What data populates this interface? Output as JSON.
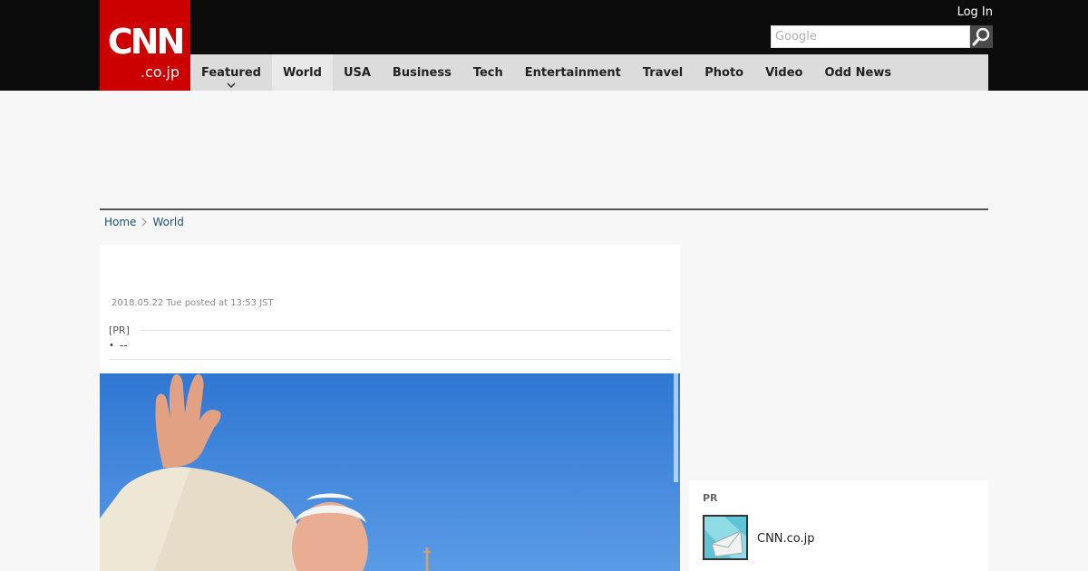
{
  "header": {
    "logo_text": "CNN",
    "logo_sub": ".co.jp",
    "login_label": "Log In",
    "search_placeholder": "Google",
    "colors": {
      "brand_red": "#cc0000",
      "topbar": "#0c0c0c",
      "nav_bg": "#dcdcdc"
    }
  },
  "nav": {
    "items": [
      {
        "label": "Featured"
      },
      {
        "label": "World"
      },
      {
        "label": "USA"
      },
      {
        "label": "Business"
      },
      {
        "label": "Tech"
      },
      {
        "label": "Entertainment"
      },
      {
        "label": "Travel"
      },
      {
        "label": "Photo"
      },
      {
        "label": "Video"
      },
      {
        "label": "Odd News"
      }
    ],
    "active": "World"
  },
  "breadcrumb": {
    "home": "Home",
    "section": "World"
  },
  "article": {
    "posted": "2018.05.22 Tue posted at 13:53 JST",
    "pr_label": "[PR]",
    "pr_link": "--",
    "photo_icon": "photo-image"
  },
  "sidebar": {
    "pr_label": "PR",
    "item_name": "CNN.co.jp",
    "thumb_icon": "mail-thumbnail-icon"
  }
}
